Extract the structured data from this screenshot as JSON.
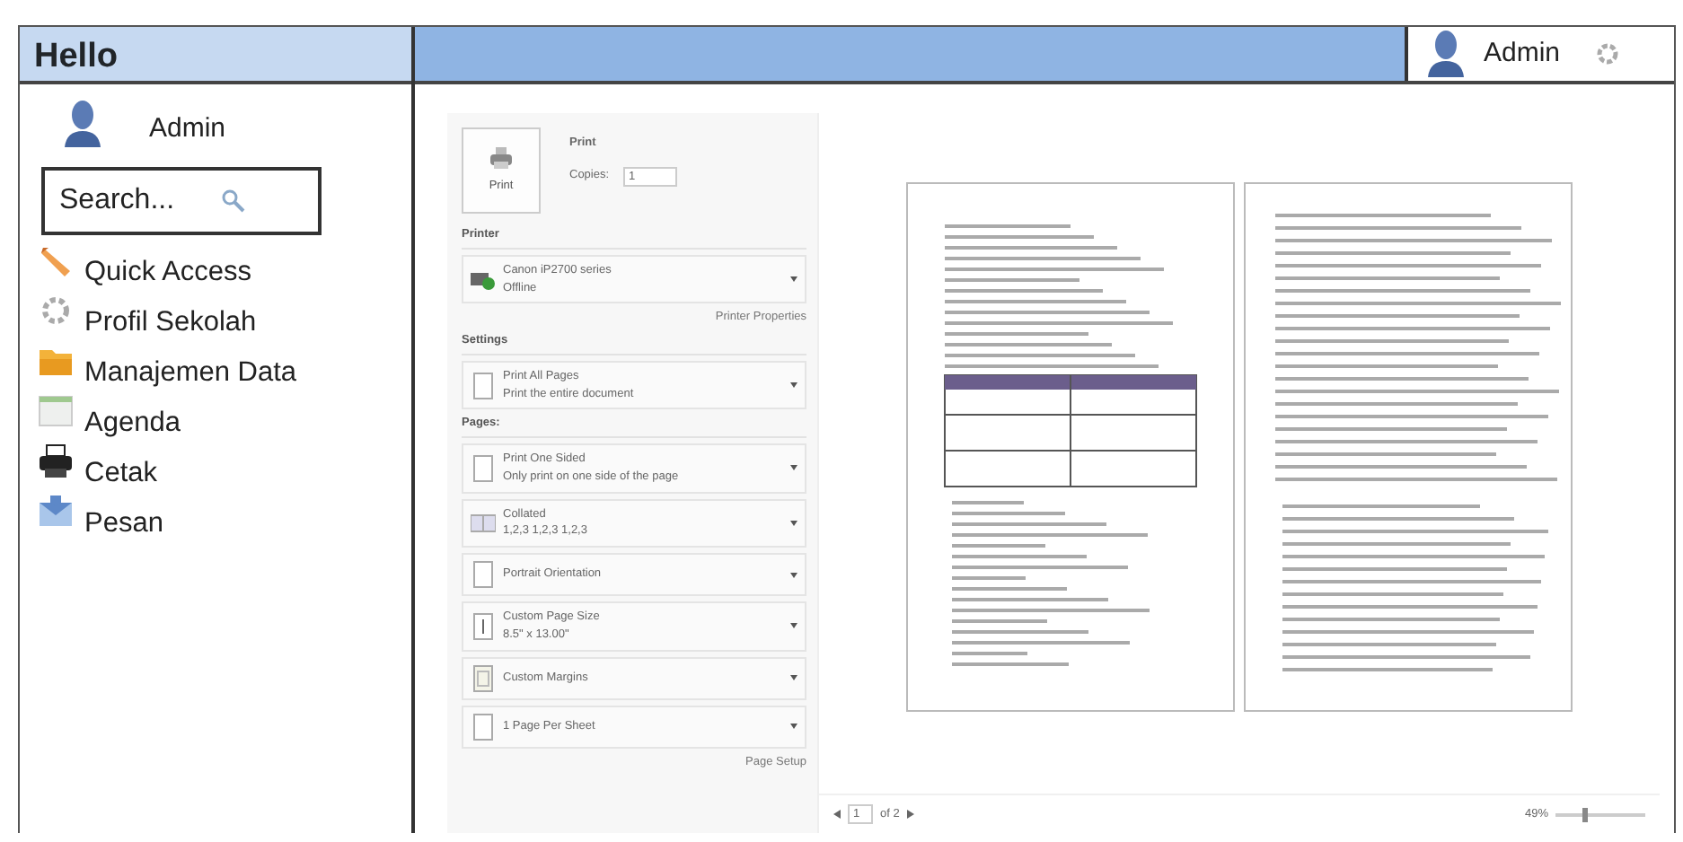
{
  "sidebar": {
    "title": "Hello",
    "user": "Admin",
    "search": {
      "placeholder": "Search..."
    },
    "items": [
      {
        "label": "Quick Access",
        "kind": "pencil"
      },
      {
        "label": "Profil Sekolah",
        "kind": "gear"
      },
      {
        "label": "Manajemen Data",
        "kind": "folder"
      },
      {
        "label": "Agenda",
        "kind": "calendar"
      },
      {
        "label": "Cetak",
        "kind": "printer"
      },
      {
        "label": "Pesan",
        "kind": "mail"
      }
    ]
  },
  "header": {
    "user": "Admin"
  },
  "print_panel": {
    "title": "Print",
    "button": "Print",
    "copies_label": "Copies:",
    "copies": "1",
    "printer_heading": "Printer",
    "printer": {
      "name": "Canon iP2700 series",
      "status": "Offline"
    },
    "printer_link": "Printer Properties",
    "settings_heading": "Settings",
    "settings": [
      {
        "title": "Print All Pages",
        "subtitle": "Print the entire document",
        "kind": "page"
      }
    ],
    "pages_label": "Pages:",
    "options": [
      {
        "title": "Print One Sided",
        "subtitle": "Only print on one side of the page",
        "kind": "page"
      },
      {
        "title": "Collated",
        "subtitle": "1,2,3   1,2,3   1,2,3",
        "kind": "collate"
      },
      {
        "title": "Portrait Orientation",
        "kind": "page"
      },
      {
        "title": "Custom Page Size",
        "subtitle": "8.5\" x 13.00\"",
        "kind": "size"
      },
      {
        "title": "Custom Margins",
        "kind": "margins"
      },
      {
        "title": "1 Page Per Sheet",
        "kind": "page"
      }
    ],
    "setup_link": "Page Setup"
  },
  "preview": {
    "page": "1",
    "page_count": "of 2",
    "zoom": "49%",
    "level": 0.3
  }
}
